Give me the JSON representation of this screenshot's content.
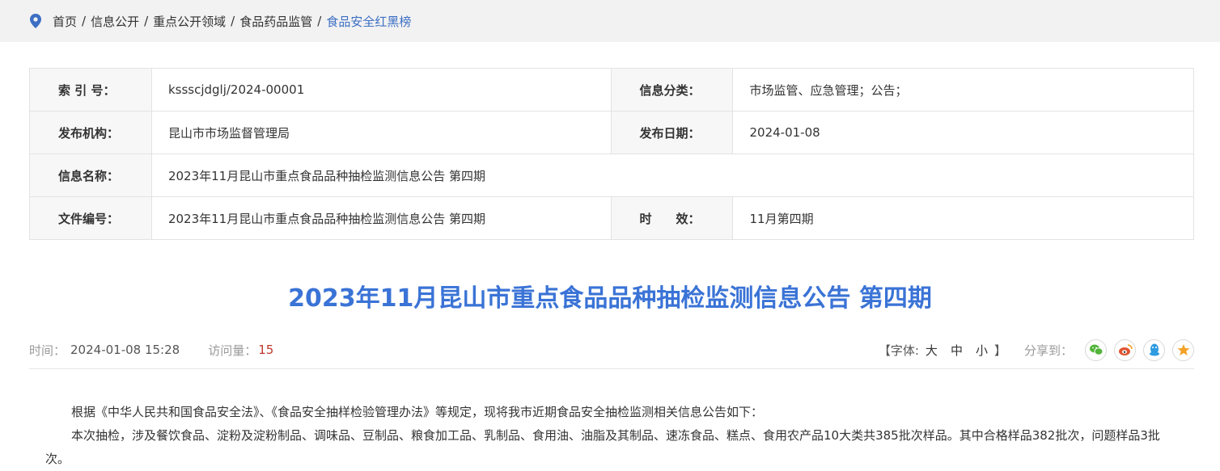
{
  "breadcrumb": {
    "items": [
      "首页",
      "信息公开",
      "重点公开领域",
      "食品药品监管",
      "食品安全红黑榜"
    ],
    "separator": "/"
  },
  "info_table": {
    "index_label": "索 引 号：",
    "index_value": "kssscjdglj/2024-00001",
    "category_label": "信息分类：",
    "category_value": "市场监管、应急管理；公告；",
    "publisher_label": "发布机构：",
    "publisher_value": "昆山市市场监督管理局",
    "date_label": "发布日期：",
    "date_value": "2024-01-08",
    "name_label": "信息名称：",
    "name_value": "2023年11月昆山市重点食品品种抽检监测信息公告 第四期",
    "doc_no_label": "文件编号：",
    "doc_no_value": "2023年11月昆山市重点食品品种抽检监测信息公告 第四期",
    "validity_label": "时　　效：",
    "validity_value": "11月第四期"
  },
  "article": {
    "title": "2023年11月昆山市重点食品品种抽检监测信息公告 第四期",
    "time_label": "时间：",
    "time_value": "2024-01-08 15:28",
    "visits_label": "访问量：",
    "visits_value": "15",
    "font_label_open": "【字体:",
    "font_large": "大",
    "font_medium": "中",
    "font_small": "小",
    "font_label_close": "】",
    "share_label": "分享到：",
    "paragraph_1": "根据《中华人民共和国食品安全法》、《食品安全抽样检验管理办法》等规定，现将我市近期食品安全抽检监测相关信息公告如下：",
    "paragraph_2": "本次抽检，涉及餐饮食品、淀粉及淀粉制品、调味品、豆制品、粮食加工品、乳制品、食用油、油脂及其制品、速冻食品、糕点、食用农产品10大类共385批次样品。其中合格样品382批次，问题样品3批次。"
  },
  "colors": {
    "accent": "#3a73d6",
    "breadcrumb_active": "#3d6fc4",
    "wechat": "#52b43a",
    "weibo": "#e0532f",
    "qq": "#2f9be0",
    "favorite": "#f3a024"
  }
}
